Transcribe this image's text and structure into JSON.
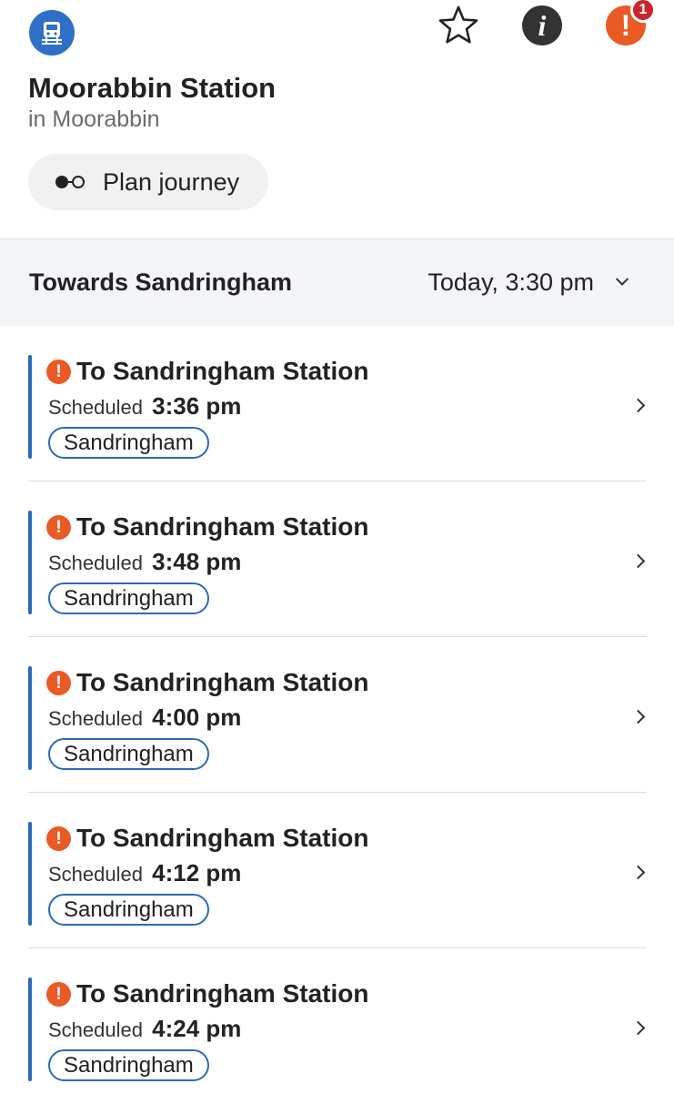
{
  "header": {
    "station_name": "Moorabbin Station",
    "suburb": "in Moorabbin",
    "plan_journey_label": "Plan journey",
    "icons": {
      "logo": "train-icon",
      "favourite": "star-icon",
      "info": "info-icon",
      "alerts": "alert-icon"
    },
    "info_glyph": "i",
    "alert_glyph": "!",
    "alert_count": "1"
  },
  "direction": {
    "label": "Towards Sandringham",
    "time": "Today, 3:30 pm"
  },
  "departures": [
    {
      "destination": "To Sandringham Station",
      "scheduled_label": "Scheduled",
      "time": "3:36 pm",
      "line": "Sandringham"
    },
    {
      "destination": "To Sandringham Station",
      "scheduled_label": "Scheduled",
      "time": "3:48 pm",
      "line": "Sandringham"
    },
    {
      "destination": "To Sandringham Station",
      "scheduled_label": "Scheduled",
      "time": "4:00 pm",
      "line": "Sandringham"
    },
    {
      "destination": "To Sandringham Station",
      "scheduled_label": "Scheduled",
      "time": "4:12 pm",
      "line": "Sandringham"
    },
    {
      "destination": "To Sandringham Station",
      "scheduled_label": "Scheduled",
      "time": "4:24 pm",
      "line": "Sandringham"
    }
  ],
  "colors": {
    "brand_blue": "#2f6fc8",
    "line_blue": "#2b6ab8",
    "alert_orange": "#ea5a25",
    "badge_red": "#c8252c"
  }
}
